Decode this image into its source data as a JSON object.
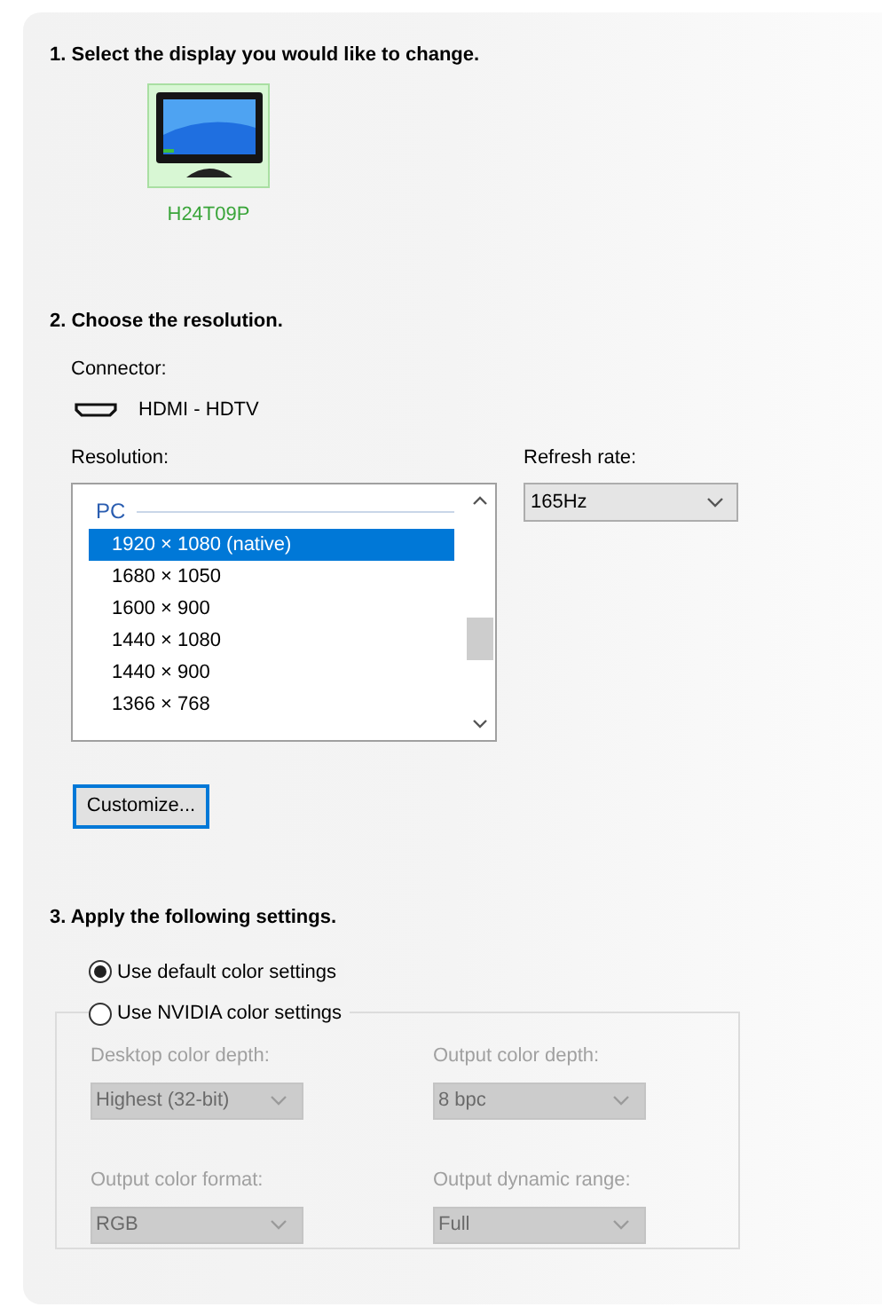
{
  "sections": [
    {
      "heading": "1. Select the display you would like to change."
    },
    {
      "heading": "2. Choose the resolution."
    },
    {
      "heading": "3. Apply the following settings."
    }
  ],
  "displays": [
    {
      "name": "H24T09P",
      "selected": true
    }
  ],
  "connector": {
    "label": "Connector:",
    "value": "HDMI - HDTV"
  },
  "resolution": {
    "label": "Resolution:",
    "group": "PC",
    "items": [
      {
        "text": "1920 × 1080 (native)",
        "selected": true
      },
      {
        "text": "1680 × 1050",
        "selected": false
      },
      {
        "text": "1600 × 900",
        "selected": false
      },
      {
        "text": "1440 × 1080",
        "selected": false
      },
      {
        "text": "1440 × 900",
        "selected": false
      },
      {
        "text": "1366 × 768",
        "selected": false
      }
    ]
  },
  "refresh_rate": {
    "label": "Refresh rate:",
    "value": "165Hz"
  },
  "customize_button": "Customize...",
  "color_options": [
    {
      "label": "Use default color settings",
      "selected": true
    },
    {
      "label": "Use NVIDIA color settings",
      "selected": false
    }
  ],
  "color_settings": {
    "disabled": true,
    "fields": [
      {
        "label": "Desktop color depth:",
        "value": "Highest (32-bit)"
      },
      {
        "label": "Output color depth:",
        "value": "8 bpc"
      },
      {
        "label": "Output color format:",
        "value": "RGB"
      },
      {
        "label": "Output dynamic range:",
        "value": "Full"
      }
    ]
  }
}
